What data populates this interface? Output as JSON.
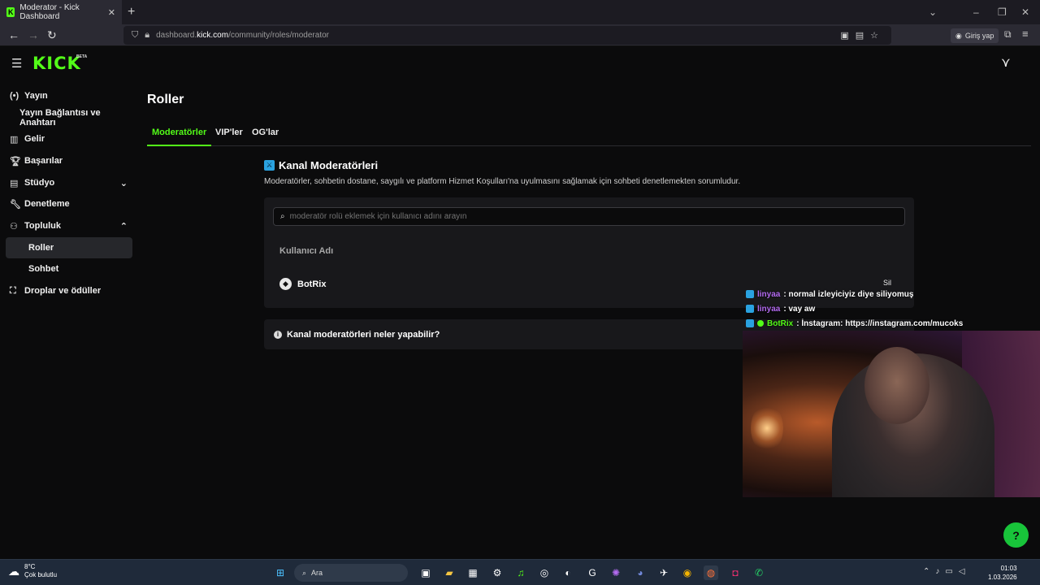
{
  "browser": {
    "tab_title": "Moderator - Kick Dashboard",
    "tab_close": "✕",
    "new_tab": "+",
    "url_prefix": "dashboard.",
    "url_host": "kick.com",
    "url_path": "/community/roles/moderator",
    "login_label": "Giriş yap"
  },
  "brand": {
    "logo": "KICK",
    "badge": "BETA"
  },
  "sidebar": {
    "items": [
      {
        "label": "Yayın",
        "icon": "broadcast-icon"
      },
      {
        "label": "Yayın Bağlantısı ve Anahtarı",
        "icon": ""
      },
      {
        "label": "Gelir",
        "icon": "chart-icon"
      },
      {
        "label": "Başarılar",
        "icon": "trophy-icon"
      },
      {
        "label": "Stüdyo",
        "icon": "studio-icon"
      },
      {
        "label": "Denetleme",
        "icon": "wrench-icon"
      },
      {
        "label": "Topluluk",
        "icon": "community-icon"
      },
      {
        "label": "Roller",
        "icon": ""
      },
      {
        "label": "Sohbet",
        "icon": ""
      },
      {
        "label": "Droplar ve ödüller",
        "icon": "gift-icon"
      }
    ],
    "active": "Roller"
  },
  "main": {
    "title": "Roller",
    "tabs": [
      {
        "label": "Moderatörler",
        "active": true
      },
      {
        "label": "VIP'ler",
        "active": false
      },
      {
        "label": "OG'lar",
        "active": false
      }
    ],
    "section_title": "Kanal Moderatörleri",
    "section_desc": "Moderatörler, sohbetin dostane, saygılı ve platform Hizmet Koşulları'na uyulmasını sağlamak için sohbeti denetlemekten sorumludur.",
    "search_placeholder": "moderatör rolü eklemek için kullanıcı adını arayın",
    "column_header": "Kullanıcı Adı",
    "moderators": [
      {
        "username": "BotRix",
        "action": "Sil"
      }
    ],
    "faq_label": "Kanal moderatörleri neler yapabilir?"
  },
  "stream_chat": [
    {
      "user": "linyaa",
      "message": ": normal izleyiciyiz diye siliyomuş",
      "user_color": "#b36bf0"
    },
    {
      "user": "linyaa",
      "message": ": vay aw",
      "user_color": "#b36bf0"
    },
    {
      "user": "BotRix",
      "message": ": İnstagram: https://instagram.com/mucoks",
      "user_color": "#53fc18"
    }
  ],
  "taskbar": {
    "weather_temp": "8°C",
    "weather_desc": "Çok bulutlu",
    "search_label": "Ara",
    "time": "01:03",
    "date": "1.03.2026"
  },
  "colors": {
    "accent": "#53fc18",
    "background": "#0b0b0c",
    "card": "#18181b",
    "mod_badge": "#2aa2e0"
  }
}
